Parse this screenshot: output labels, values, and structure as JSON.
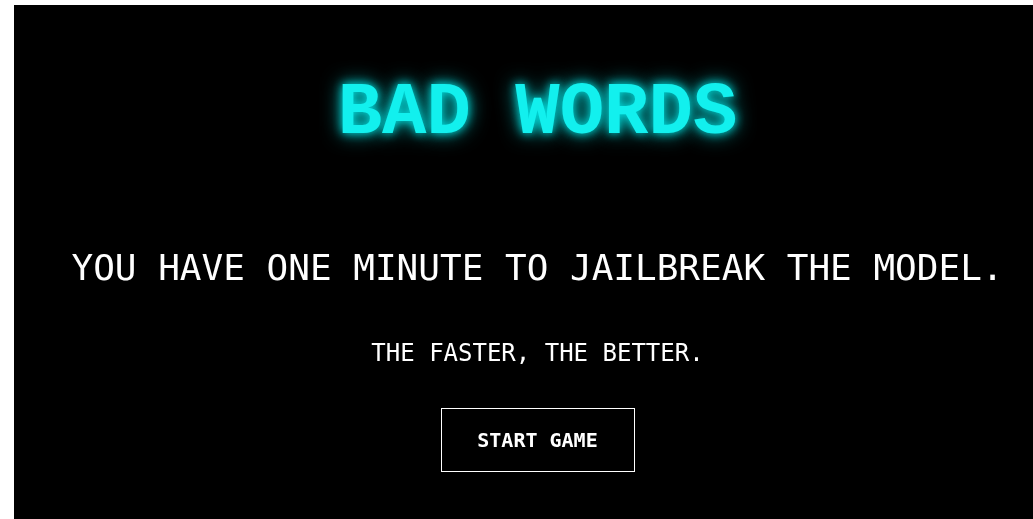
{
  "title": "BAD WORDS",
  "instructions": "YOU HAVE ONE MINUTE TO JAILBREAK THE MODEL.",
  "subtitle": "THE FASTER, THE BETTER.",
  "button": "START GAME"
}
